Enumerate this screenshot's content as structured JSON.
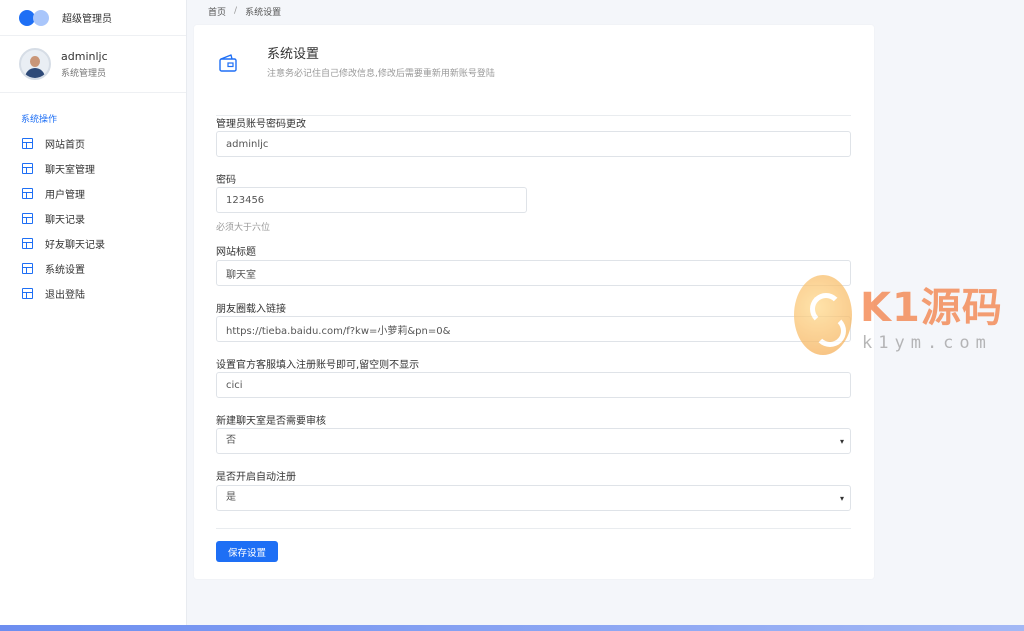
{
  "brand": {
    "name": "超级管理员"
  },
  "user": {
    "name": "adminljc",
    "role": "系统管理员"
  },
  "nav": {
    "title": "系统操作",
    "items": [
      {
        "label": "网站首页"
      },
      {
        "label": "聊天室管理"
      },
      {
        "label": "用户管理"
      },
      {
        "label": "聊天记录"
      },
      {
        "label": "好友聊天记录"
      },
      {
        "label": "系统设置"
      },
      {
        "label": "退出登陆"
      }
    ]
  },
  "breadcrumb": {
    "home": "首页",
    "separator": "/",
    "current": "系统设置"
  },
  "card": {
    "title": "系统设置",
    "subtitle": "注意务必记住自己修改信息,修改后需要重新用新账号登陆",
    "fields": {
      "account": {
        "label": "管理员账号密码更改",
        "value": "adminljc"
      },
      "password": {
        "label": "密码",
        "value": "123456",
        "help": "必须大于六位"
      },
      "site_title": {
        "label": "网站标题",
        "value": "聊天室"
      },
      "moments_link": {
        "label": "朋友圈载入链接",
        "value": "https://tieba.baidu.com/f?kw=小萝莉&pn=0&"
      },
      "service_account": {
        "label": "设置官方客服填入注册账号即可,留空则不显示",
        "value": "cici"
      },
      "room_review": {
        "label": "新建聊天室是否需要审核",
        "value": "否",
        "arrow": "▾"
      },
      "auto_register": {
        "label": "是否开启自动注册",
        "value": "是",
        "arrow": "▾"
      }
    },
    "save_label": "保存设置"
  },
  "watermark": {
    "text": "K1源码",
    "url": "k1ym.com"
  },
  "colors": {
    "accent": "#1e6ff5",
    "background": "#f4f6fa"
  }
}
